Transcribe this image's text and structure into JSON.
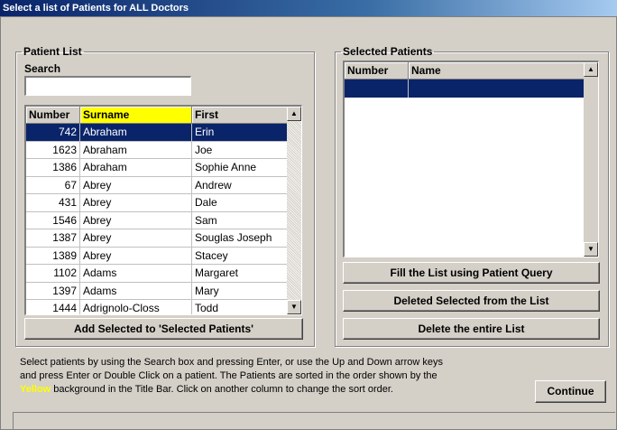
{
  "window": {
    "title": "Select a list of Patients for ALL Doctors"
  },
  "patient_list": {
    "legend": "Patient List",
    "search_label": "Search",
    "search_value": "",
    "columns": [
      "Number",
      "Surname",
      "First"
    ],
    "sorted_column": "Surname",
    "rows": [
      {
        "number": "742",
        "surname": "Abraham",
        "first": "Erin"
      },
      {
        "number": "1623",
        "surname": "Abraham",
        "first": "Joe"
      },
      {
        "number": "1386",
        "surname": "Abraham",
        "first": "Sophie Anne"
      },
      {
        "number": "67",
        "surname": "Abrey",
        "first": "Andrew"
      },
      {
        "number": "431",
        "surname": "Abrey",
        "first": "Dale"
      },
      {
        "number": "1546",
        "surname": "Abrey",
        "first": "Sam"
      },
      {
        "number": "1387",
        "surname": "Abrey",
        "first": "Souglas Joseph"
      },
      {
        "number": "1389",
        "surname": "Abrey",
        "first": "Stacey"
      },
      {
        "number": "1102",
        "surname": "Adams",
        "first": "Margaret"
      },
      {
        "number": "1397",
        "surname": "Adams",
        "first": "Mary"
      },
      {
        "number": "1444",
        "surname": "Adrignolo-Closs",
        "first": "Todd"
      }
    ],
    "add_button": "Add Selected to 'Selected Patients'"
  },
  "selected_patients": {
    "legend": "Selected Patients",
    "columns": [
      "Number",
      "Name"
    ],
    "fill_button": "Fill the List using Patient Query",
    "delete_selected_button": "Deleted Selected from the List",
    "delete_all_button": "Delete the entire List"
  },
  "help": {
    "line1": "Select patients by using the Search box and pressing Enter, or use the Up and Down arrow keys",
    "line2": "and press Enter or Double Click on a patient. The Patients are sorted in the order shown by the",
    "yellow_word": "Yellow",
    "line3_rest": " background in the Title Bar. Click on another column to change the sort order."
  },
  "continue_button": "Continue",
  "colors": {
    "title_bar": "#0a246a",
    "selection": "#0a246a",
    "sort_highlight": "#ffff00",
    "face": "#d4d0c8"
  },
  "icons": {
    "scroll_up": "triangle-up",
    "scroll_down": "triangle-down"
  }
}
